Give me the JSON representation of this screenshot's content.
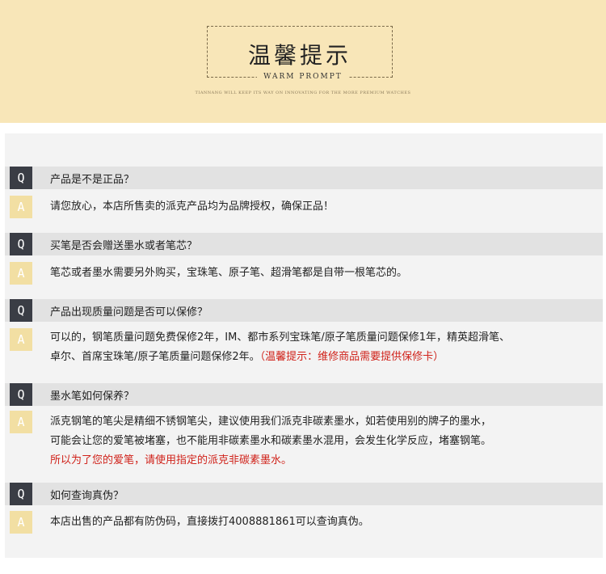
{
  "header": {
    "title": "温馨提示",
    "subtitle": "WARM PROMPT",
    "tagline": "TIANNANG WILL KEEP ITS WAY ON INNOVATING FOR THE MORE PREMIUM WATCHES"
  },
  "colors": {
    "header_bg": "#f8e6b8",
    "q_badge": "#3a3d45",
    "a_badge": "#f2dfa3",
    "highlight": "#d0221a"
  },
  "faq": [
    {
      "q_badge": "Q",
      "question": "产品是不是正品？",
      "a_badge": "A",
      "answer_lines": [
        "请您放心，本店所售卖的派克产品均为品牌授权，确保正品！"
      ]
    },
    {
      "q_badge": "Q",
      "question": "买笔是否会赠送墨水或者笔芯？",
      "a_badge": "A",
      "answer_lines": [
        "笔芯或者墨水需要另外购买，宝珠笔、原子笔、超滑笔都是自带一根笔芯的。"
      ]
    },
    {
      "q_badge": "Q",
      "question": "产品出现质量问题是否可以保修？",
      "a_badge": "A",
      "answer_line1": "可以的，钢笔质量问题免费保修2年，IM、都市系列宝珠笔/原子笔质量问题保修1年，精英超滑笔、",
      "answer_line2": "卓尔、首席宝珠笔/原子笔质量问题保修2年。",
      "answer_note": "（温馨提示：维修商品需要提供保修卡）"
    },
    {
      "q_badge": "Q",
      "question": "墨水笔如何保养？",
      "a_badge": "A",
      "answer_line1": "派克钢笔的笔尖是精细不锈钢笔尖，建议使用我们派克非碳素墨水，如若使用别的牌子的墨水，",
      "answer_line2": "可能会让您的爱笔被堵塞，也不能用非碳素墨水和碳素墨水混用，会发生化学反应，堵塞钢笔。",
      "answer_note": "所以为了您的爱笔，请使用指定的派克非碳素墨水。"
    },
    {
      "q_badge": "Q",
      "question": "如何查询真伪？",
      "a_badge": "A",
      "answer_lines": [
        "本店出售的产品都有防伪码，直接拨打4008881861可以查询真伪。"
      ]
    }
  ]
}
